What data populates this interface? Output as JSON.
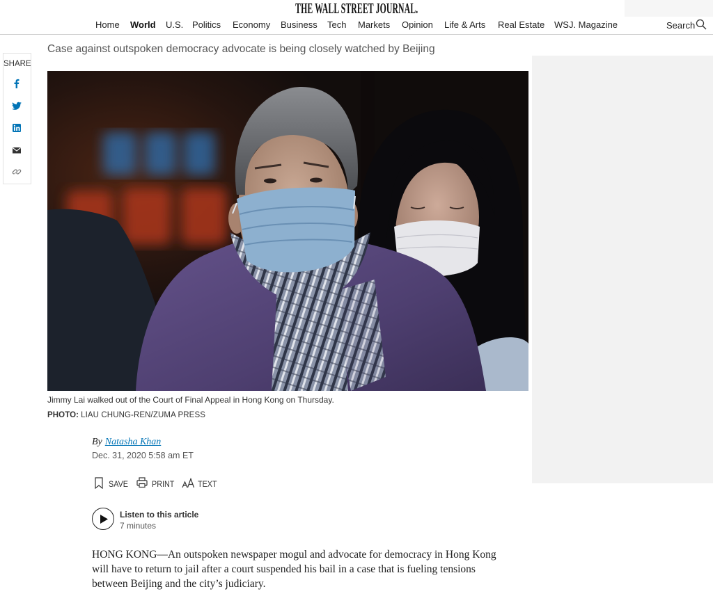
{
  "page": {
    "colors": {
      "link": "#0274b6",
      "share_icon": "#0274b6",
      "sidebar_bg": "#f2f2f2",
      "text": "#222222",
      "muted": "#555555"
    }
  },
  "masthead": {
    "title": "THE WALL STREET JOURNAL."
  },
  "nav": {
    "items": [
      {
        "label": "Home",
        "active": false
      },
      {
        "label": "World",
        "active": true
      },
      {
        "label": "U.S.",
        "active": false
      },
      {
        "label": "Politics",
        "active": false
      },
      {
        "label": "Economy",
        "active": false
      },
      {
        "label": "Business",
        "active": false
      },
      {
        "label": "Tech",
        "active": false
      },
      {
        "label": "Markets",
        "active": false
      },
      {
        "label": "Opinion",
        "active": false
      },
      {
        "label": "Life & Arts",
        "active": false
      },
      {
        "label": "Real Estate",
        "active": false
      },
      {
        "label": "WSJ. Magazine",
        "active": false
      }
    ],
    "search_label": "Search",
    "search_icon": "search-icon"
  },
  "share": {
    "label": "SHARE",
    "icons": [
      "facebook-icon",
      "twitter-icon",
      "linkedin-icon",
      "email-icon",
      "link-icon"
    ]
  },
  "article": {
    "subheading": "Case against outspoken democracy advocate is being closely watched by Beijing",
    "photo": {
      "caption": "Jimmy Lai walked out of the Court of Final Appeal in Hong Kong on Thursday.",
      "credit_label": "PHOTO:",
      "credit": "LIAU CHUNG-REN/ZUMA PRESS"
    },
    "byline": {
      "prefix": "By",
      "author": "Natasha Khan",
      "timestamp": "Dec. 31, 2020 5:58 am ET"
    },
    "tools": {
      "save": "SAVE",
      "print": "PRINT",
      "text": "TEXT",
      "icons": [
        "bookmark-icon",
        "printer-icon",
        "text-size-icon"
      ]
    },
    "audio": {
      "label": "Listen to this article",
      "duration": "7 minutes",
      "icon": "play-icon"
    },
    "body_lines": [
      "HONG KONG—An outspoken newspaper mogul and advocate for democracy in Hong Kong",
      "will have to return to jail after a court suspended his bail in a case that is fueling tensions",
      "between Beijing and the city’s judiciary."
    ]
  }
}
